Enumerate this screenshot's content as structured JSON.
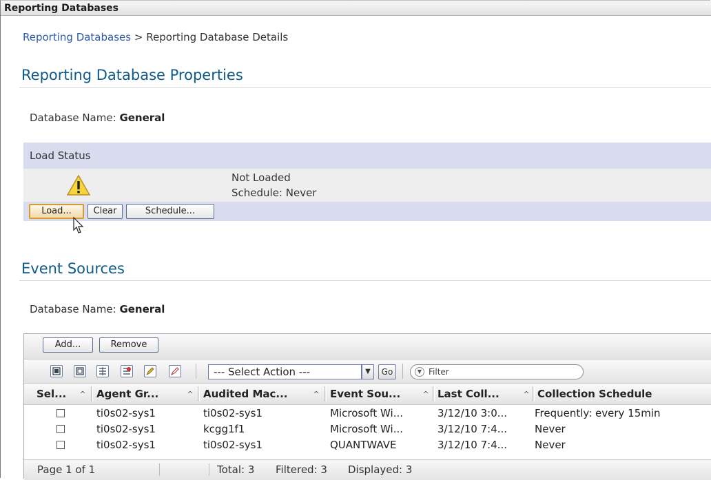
{
  "header": {
    "title": "Reporting Databases"
  },
  "breadcrumb": {
    "link": "Reporting Databases",
    "separator": ">",
    "current": "Reporting Database Details"
  },
  "properties": {
    "title": "Reporting Database Properties",
    "db_label": "Database Name:",
    "db_value": "General"
  },
  "load_status": {
    "header": "Load Status",
    "status": "Not Loaded",
    "schedule": "Schedule: Never",
    "buttons": {
      "load": "Load...",
      "clear": "Clear",
      "schedule": "Schedule..."
    }
  },
  "event_sources": {
    "title": "Event Sources",
    "db_label": "Database Name:",
    "db_value": "General",
    "buttons": {
      "add": "Add...",
      "remove": "Remove"
    },
    "select_action": "--- Select Action ---",
    "go": "Go",
    "filter_placeholder": "Filter",
    "columns": [
      "Sel...",
      "Agent Gr...",
      "Audited Mac...",
      "Event Sou...",
      "Last Coll...",
      "Collection Schedule"
    ],
    "rows": [
      {
        "agent": "ti0s02-sys1",
        "machine": "ti0s02-sys1",
        "source": "Microsoft Wi...",
        "last": "3/12/10 3:0...",
        "schedule": "Frequently: every 15min"
      },
      {
        "agent": "ti0s02-sys1",
        "machine": "kcgg1f1",
        "source": "Microsoft Wi...",
        "last": "3/12/10 7:4...",
        "schedule": "Never"
      },
      {
        "agent": "ti0s02-sys1",
        "machine": "ti0s02-sys1",
        "source": "QUANTWAVE",
        "last": "3/12/10 7:4...",
        "schedule": "Never"
      }
    ],
    "footer": {
      "page": "Page 1 of 1",
      "total": "Total: 3",
      "filtered": "Filtered: 3",
      "displayed": "Displayed: 3"
    }
  },
  "colors": {
    "accent_title": "#0f5a88",
    "link": "#2b5aa8",
    "band": "#d9dbef",
    "warning": "#f6d43a"
  },
  "icons": [
    "warning-icon",
    "select-all-icon",
    "deselect-all-icon",
    "expand-icon",
    "collapse-icon",
    "edit-icon",
    "clear-icon",
    "dropdown-arrow-icon",
    "filter-icon",
    "sort-icon",
    "mouse-pointer-icon"
  ]
}
